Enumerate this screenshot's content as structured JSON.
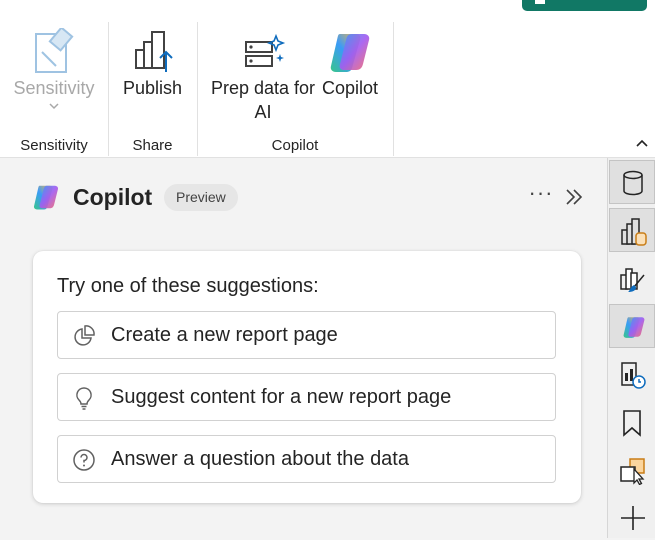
{
  "ribbon": {
    "groups": [
      {
        "name": "Sensitivity",
        "buttons": [
          {
            "label": "Sensitivity",
            "icon": "sensitivity-label-icon",
            "disabled": true,
            "has_dropdown": true
          }
        ]
      },
      {
        "name": "Share",
        "buttons": [
          {
            "label": "Publish",
            "icon": "publish-icon"
          }
        ]
      },
      {
        "name": "Copilot",
        "buttons": [
          {
            "label_line1": "Prep data for",
            "label_line2": "AI",
            "icon": "prep-data-ai-icon"
          },
          {
            "label": "Copilot",
            "icon": "copilot-icon"
          }
        ]
      }
    ]
  },
  "pane": {
    "title": "Copilot",
    "badge": "Preview",
    "more_icon": "more-options-icon",
    "expand_icon": "double-chevron-right-icon",
    "card": {
      "heading": "Try one of these suggestions:",
      "suggestions": [
        {
          "label": "Create a new report page",
          "icon": "pie-chart-icon"
        },
        {
          "label": "Suggest content for a new report page",
          "icon": "lightbulb-icon"
        },
        {
          "label": "Answer a question about the data",
          "icon": "question-circle-icon"
        }
      ]
    }
  },
  "rail": {
    "items": [
      {
        "icon": "data-icon",
        "active": true
      },
      {
        "icon": "build-visual-icon",
        "active": true
      },
      {
        "icon": "format-brush-icon",
        "active": false
      },
      {
        "icon": "copilot-icon",
        "active": true
      },
      {
        "icon": "performance-analyzer-icon",
        "active": false
      },
      {
        "icon": "bookmark-icon",
        "active": false
      },
      {
        "icon": "selection-pane-icon",
        "active": false
      },
      {
        "icon": "add-pane-icon",
        "active": false
      }
    ]
  },
  "colors": {
    "accent_green": "#117865",
    "copilot_gradient": [
      "#3a9bf8",
      "#a45cf0",
      "#f56b6b",
      "#ffb640",
      "#39c68a"
    ]
  }
}
